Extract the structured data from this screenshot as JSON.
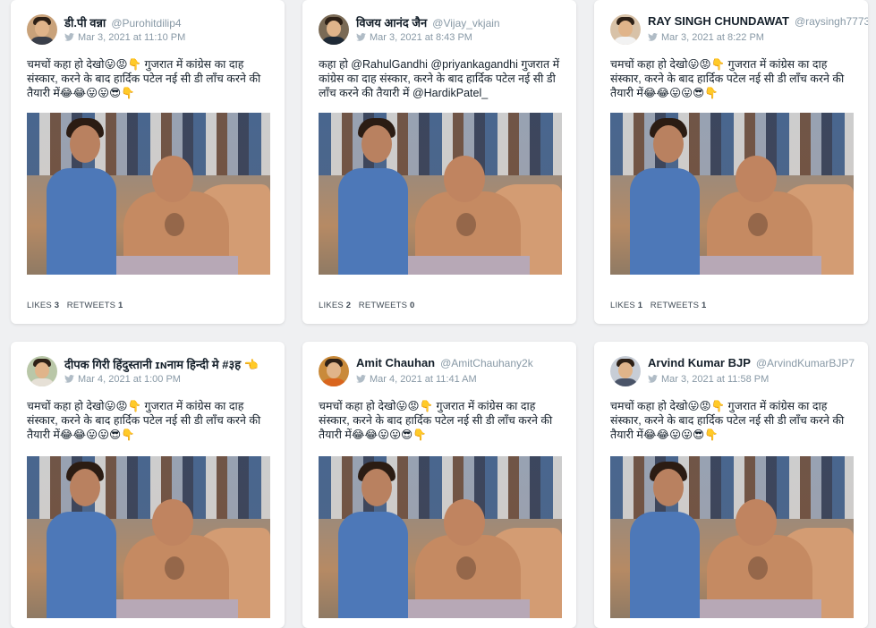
{
  "cards": [
    {
      "name": "डी.पी वन्ना",
      "handle": "@Purohitdilip4",
      "date": "Mar 3, 2021 at 11:10 PM",
      "text": "चमचों कहा हो देखो😛😡👇 गुजरात में कांग्रेस का दाह संस्कार, करने के बाद हार्दिक पटेल नई सी डी लाँच करने की तैयारी में😂😂😛😛😎👇",
      "likes_label": "LIKES",
      "likes": "3",
      "retweets_label": "RETWEETS",
      "retweets": "1"
    },
    {
      "name": "विजय आनंद जैन",
      "handle": "@Vijay_vkjain",
      "date": "Mar 3, 2021 at 8:43 PM",
      "text": "कहा हो @RahulGandhi @priyankagandhi गुजरात में कांग्रेस का दाह संस्कार, करने के बाद हार्दिक पटेल नई सी डी लाँच करने की तैयारी में @HardikPatel_",
      "likes_label": "LIKES",
      "likes": "2",
      "retweets_label": "RETWEETS",
      "retweets": "0"
    },
    {
      "name": "RAY SINGH CHUNDAWAT",
      "handle": "@raysingh7773",
      "date": "Mar 3, 2021 at 8:22 PM",
      "text": "चमचों कहा हो देखो😛😡👇 गुजरात में कांग्रेस का दाह संस्कार, करने के बाद हार्दिक पटेल नई सी डी लाँच करने की तैयारी में😂😂😛😛😎👇",
      "likes_label": "LIKES",
      "likes": "1",
      "retweets_label": "RETWEETS",
      "retweets": "1"
    },
    {
      "name": "दीपक गिरी हिंदुस्तानी ɪɴनाम हिन्दी मे #३ह 👈",
      "handle": "",
      "date": "Mar 4, 2021 at 1:00 PM",
      "text": "चमचों कहा हो देखो😛😡👇 गुजरात में कांग्रेस का दाह संस्कार, करने के बाद हार्दिक पटेल नई सी डी लाँच करने की तैयारी में😂😂😛😛😎👇",
      "likes_label": "",
      "likes": "",
      "retweets_label": "",
      "retweets": ""
    },
    {
      "name": "Amit Chauhan",
      "handle": "@AmitChauhany2k",
      "date": "Mar 4, 2021 at 11:41 AM",
      "text": "चमचों कहा हो देखो😛😡👇 गुजरात में कांग्रेस का दाह संस्कार, करने के बाद हार्दिक पटेल नई सी डी लाँच करने की तैयारी में😂😂😛😛😎👇",
      "likes_label": "",
      "likes": "",
      "retweets_label": "",
      "retweets": ""
    },
    {
      "name": "Arvind Kumar BJP",
      "handle": "@ArvindKumarBJP7",
      "date": "Mar 3, 2021 at 11:58 PM",
      "text": "चमचों कहा हो देखो😛😡👇 गुजरात में कांग्रेस का दाह संस्कार, करने के बाद हार्दिक पटेल नई सी डी लाँच करने की तैयारी में😂😂😛😛😎👇",
      "likes_label": "",
      "likes": "",
      "retweets_label": "",
      "retweets": ""
    }
  ],
  "icons": {
    "twitter": "twitter-bird-icon"
  },
  "colors": {
    "background": "#eff0f2",
    "muted": "#8899a6",
    "text": "#15202b",
    "twitter": "#b0bcc6"
  }
}
